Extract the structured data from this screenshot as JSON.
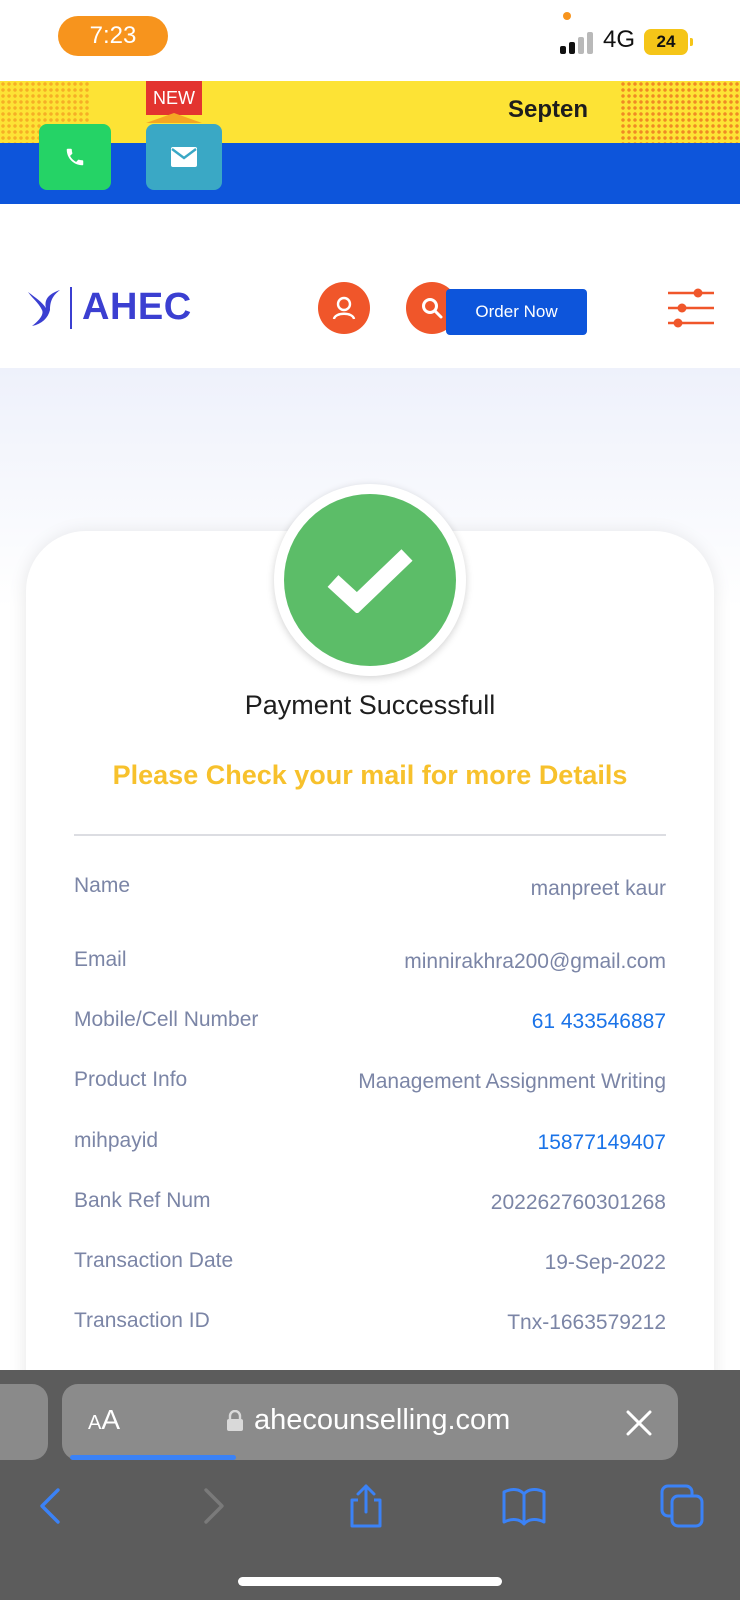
{
  "status_bar": {
    "time": "7:23",
    "network": "4G",
    "battery": "24"
  },
  "promo": {
    "badge": "NEW",
    "text": "Septen"
  },
  "header": {
    "logo_text": "AHEC",
    "order_button": "Order Now"
  },
  "payment": {
    "title": "Payment Successfull",
    "subtitle": "Please Check your mail for more Details",
    "details": [
      {
        "label": "Name",
        "value": "manpreet kaur"
      },
      {
        "label": "Email",
        "value": "minnirakhra200@gmail.com"
      },
      {
        "label": "Mobile/Cell Number",
        "value": "61 433546887"
      },
      {
        "label": "Product Info",
        "value": "Management Assignment Writing"
      },
      {
        "label": "mihpayid",
        "value": "15877149407"
      },
      {
        "label": "Bank Ref Num",
        "value": "20226276030126​8"
      },
      {
        "label": "Transaction Date",
        "value": "19-Sep-2022"
      },
      {
        "label": "Transaction ID",
        "value": "Tnx-1663579212"
      }
    ]
  },
  "browser": {
    "aa_small": "A",
    "aa_big": "A",
    "url": "ahecounselling.com",
    "page_load_progress": 0.27
  },
  "colors": {
    "brand_blue": "#0d55db",
    "accent_orange": "#f0562a",
    "success_green": "#5cbd68",
    "subtitle_yellow": "#f7c12c",
    "link_blue": "#1a73e8"
  }
}
